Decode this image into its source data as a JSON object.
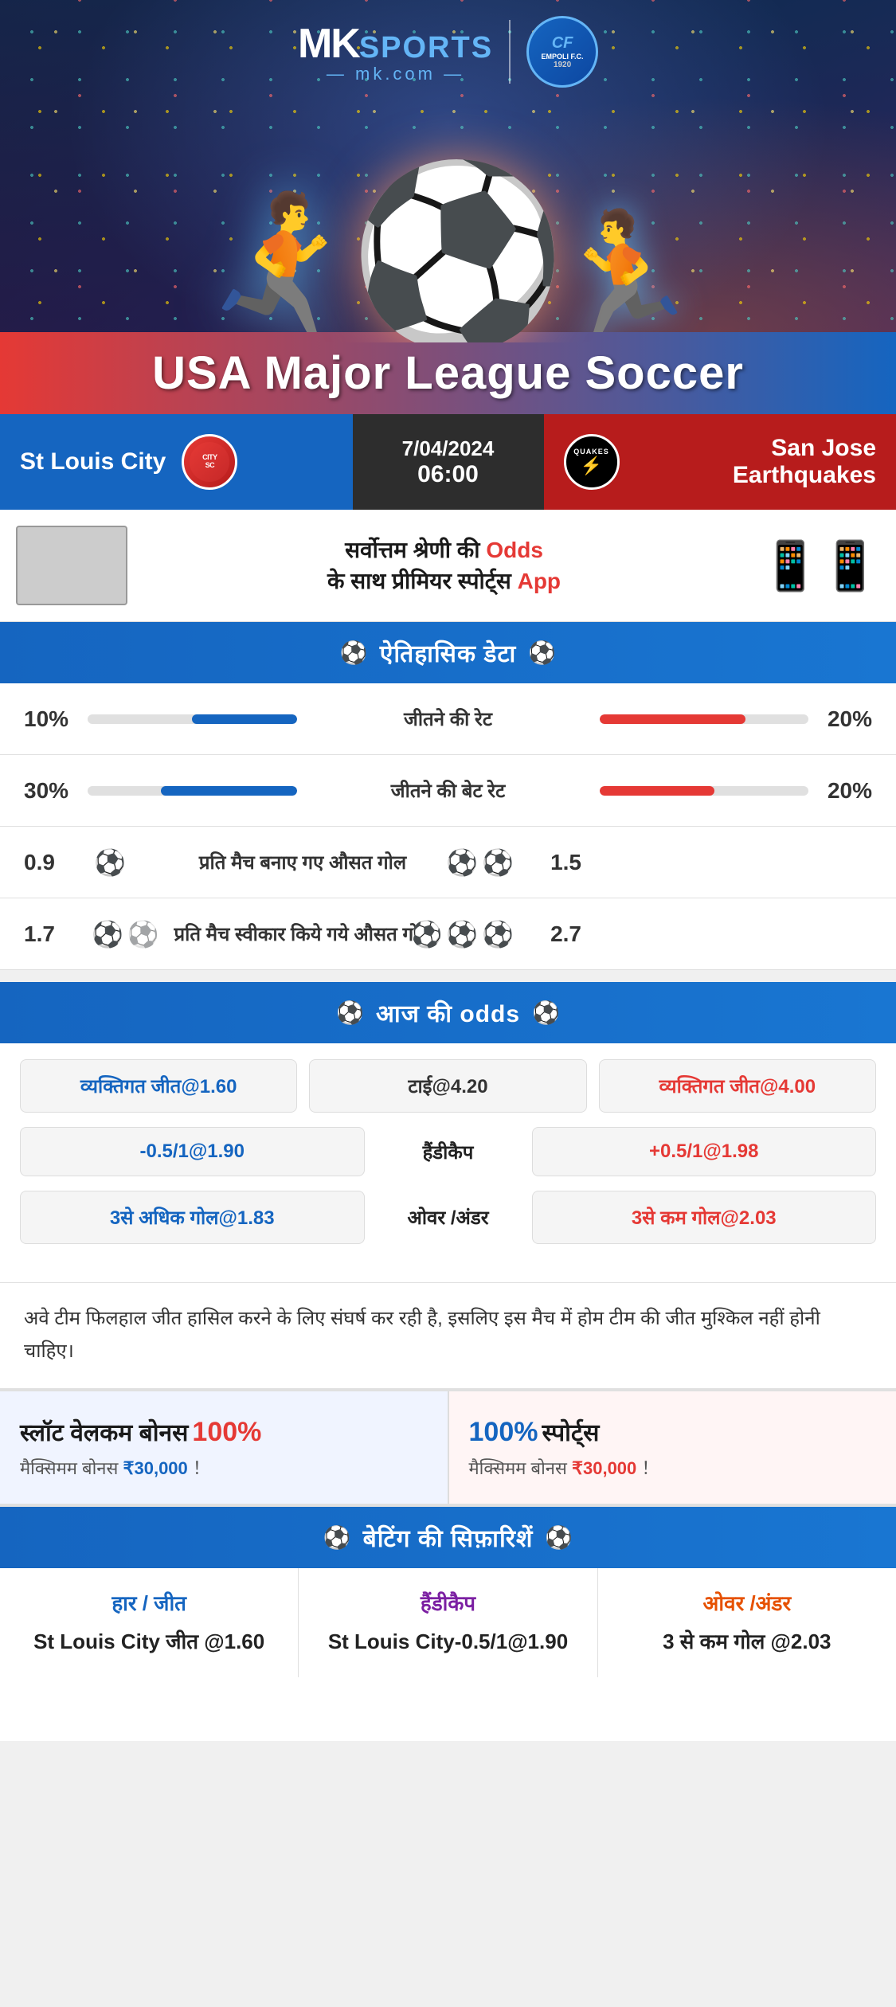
{
  "header": {
    "brand": "MK",
    "brand_sports": "SPORTS",
    "brand_url": "mk.com",
    "league_title": "USA Major League Soccer",
    "empoli": {
      "name": "EMPOLI F.C.",
      "cf": "CF",
      "year": "1920"
    }
  },
  "match": {
    "team_left": "St Louis City",
    "team_right": "San Jose Earthquakes",
    "team_right_short": "QUAKES",
    "date": "7/04/2024",
    "time": "06:00"
  },
  "promo": {
    "text_line1": "सर्वोत्तम श्रेणी की",
    "text_highlight": "Odds",
    "text_line2": "के साथ प्रीमियर स्पोर्ट्स",
    "text_app": "App"
  },
  "historical_section": {
    "title": "ऐतिहासिक डेटा",
    "rows": [
      {
        "label": "जीतने की रेट",
        "left_val": "10%",
        "right_val": "20%",
        "left_pct": 10,
        "right_pct": 20,
        "type": "bar"
      },
      {
        "label": "जीतने की बेट रेट",
        "left_val": "30%",
        "right_val": "20%",
        "left_pct": 30,
        "right_pct": 20,
        "type": "bar"
      },
      {
        "label": "प्रति मैच बनाए गए औसत गोल",
        "left_val": "0.9",
        "right_val": "1.5",
        "left_balls": 1,
        "right_balls": 2,
        "type": "ball"
      },
      {
        "label": "प्रति मैच स्वीकार किये गये औसत गोल",
        "left_val": "1.7",
        "right_val": "2.7",
        "left_balls": 2,
        "right_balls": 3,
        "type": "ball"
      }
    ]
  },
  "odds_section": {
    "title": "आज की odds",
    "rows": [
      {
        "left": "व्यक्तिगत जीत@1.60",
        "center_label": "टाई@4.20",
        "right": "व्यक्तिगत जीत@4.00",
        "center_type": "value"
      },
      {
        "left": "-0.5/1@1.90",
        "center_label": "हैंडीकैप",
        "right": "+0.5/1@1.98",
        "center_type": "label"
      },
      {
        "left": "3से अधिक गोल@1.83",
        "center_label": "ओवर /अंडर",
        "right": "3से कम गोल@2.03",
        "center_type": "label"
      }
    ]
  },
  "analysis": {
    "text": "अवे टीम फिलहाल जीत हासिल करने के लिए संघर्ष कर रही है, इसलिए इस मैच में होम टीम की जीत मुश्किल नहीं होनी चाहिए।"
  },
  "bonus": {
    "left": {
      "title": "स्लॉट वेलकम बोनस",
      "percent": "100%",
      "subtitle": "मैक्सिमम बोनस",
      "amount": "₹30,000",
      "suffix": "！"
    },
    "right": {
      "percent": "100%",
      "title": "स्पोर्ट्स",
      "subtitle": "मैक्सिमम बोनस",
      "amount": "₹30,000",
      "suffix": "！"
    }
  },
  "recommendations": {
    "title": "बेटिंग की सिफ़ारिशें",
    "cols": [
      {
        "title": "हार / जीत",
        "value": "St Louis City जीत @1.60"
      },
      {
        "title": "हैंडीकैप",
        "value": "St Louis City-0.5/1@1.90"
      },
      {
        "title": "ओवर /अंडर",
        "value": "3 से कम गोल @2.03"
      }
    ]
  }
}
